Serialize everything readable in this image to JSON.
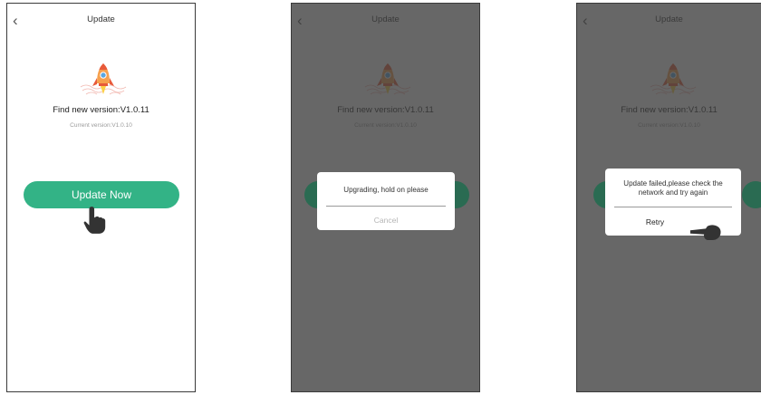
{
  "header": {
    "title": "Update",
    "back_icon": "chevron-left-icon"
  },
  "version": {
    "find_label": "Find new version:V1.0.11",
    "current_label": "Current version:V1.0.10"
  },
  "actions": {
    "update_now": "Update Now"
  },
  "dialogs": {
    "upgrading": {
      "message": "Upgrading, hold on please",
      "cancel": "Cancel"
    },
    "failed": {
      "message": "Update failed,please check the network and try again",
      "retry": "Retry"
    }
  },
  "colors": {
    "accent": "#33b386",
    "overlay": "#5a5a5a",
    "divider": "#9a9a9a"
  },
  "icons": [
    "rocket-icon",
    "pointing-hand-icon"
  ]
}
